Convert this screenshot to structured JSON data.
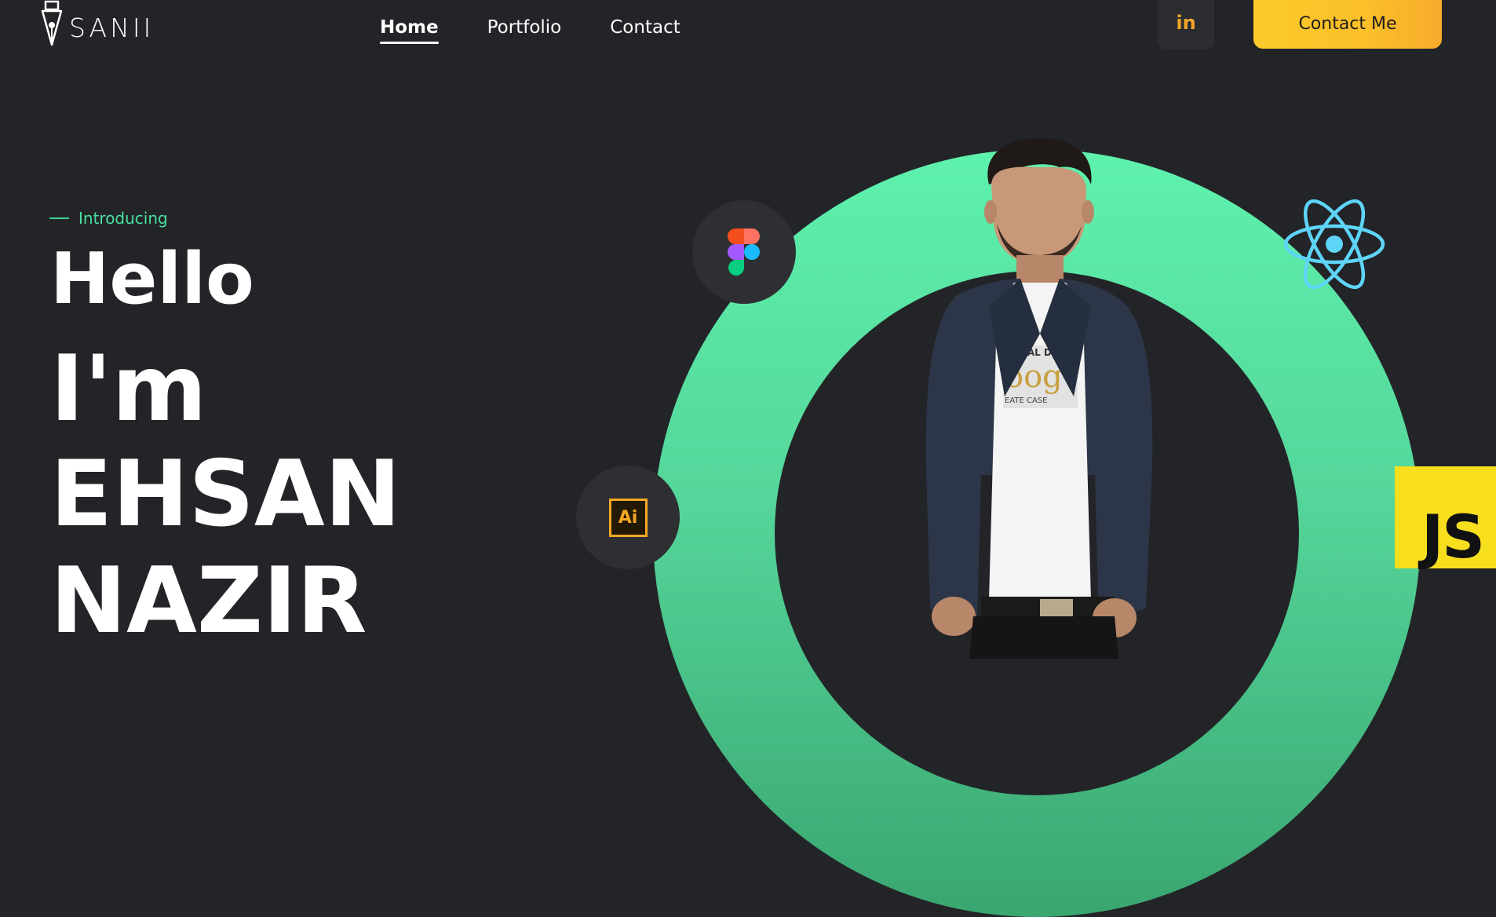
{
  "header": {
    "logo_text": "SANII",
    "nav": [
      {
        "label": "Home",
        "active": true
      },
      {
        "label": "Portfolio",
        "active": false
      },
      {
        "label": "Contact",
        "active": false
      }
    ],
    "linkedin_label": "in",
    "contact_button_label": "Contact Me"
  },
  "hero": {
    "eyebrow": "Introducing",
    "greeting": "Hello",
    "im": "I'm",
    "first_name": "EHSAN",
    "last_name": "NAZIR"
  },
  "skills": {
    "ai_label": "Ai",
    "js_label": "JS"
  },
  "colors": {
    "background": "#232428",
    "accent_green": "#46e09e",
    "accent_yellow": "#fbbf2a",
    "ring_green": "#55d69a",
    "js_yellow": "#f7df1e",
    "react_blue": "#5ed4f7"
  }
}
